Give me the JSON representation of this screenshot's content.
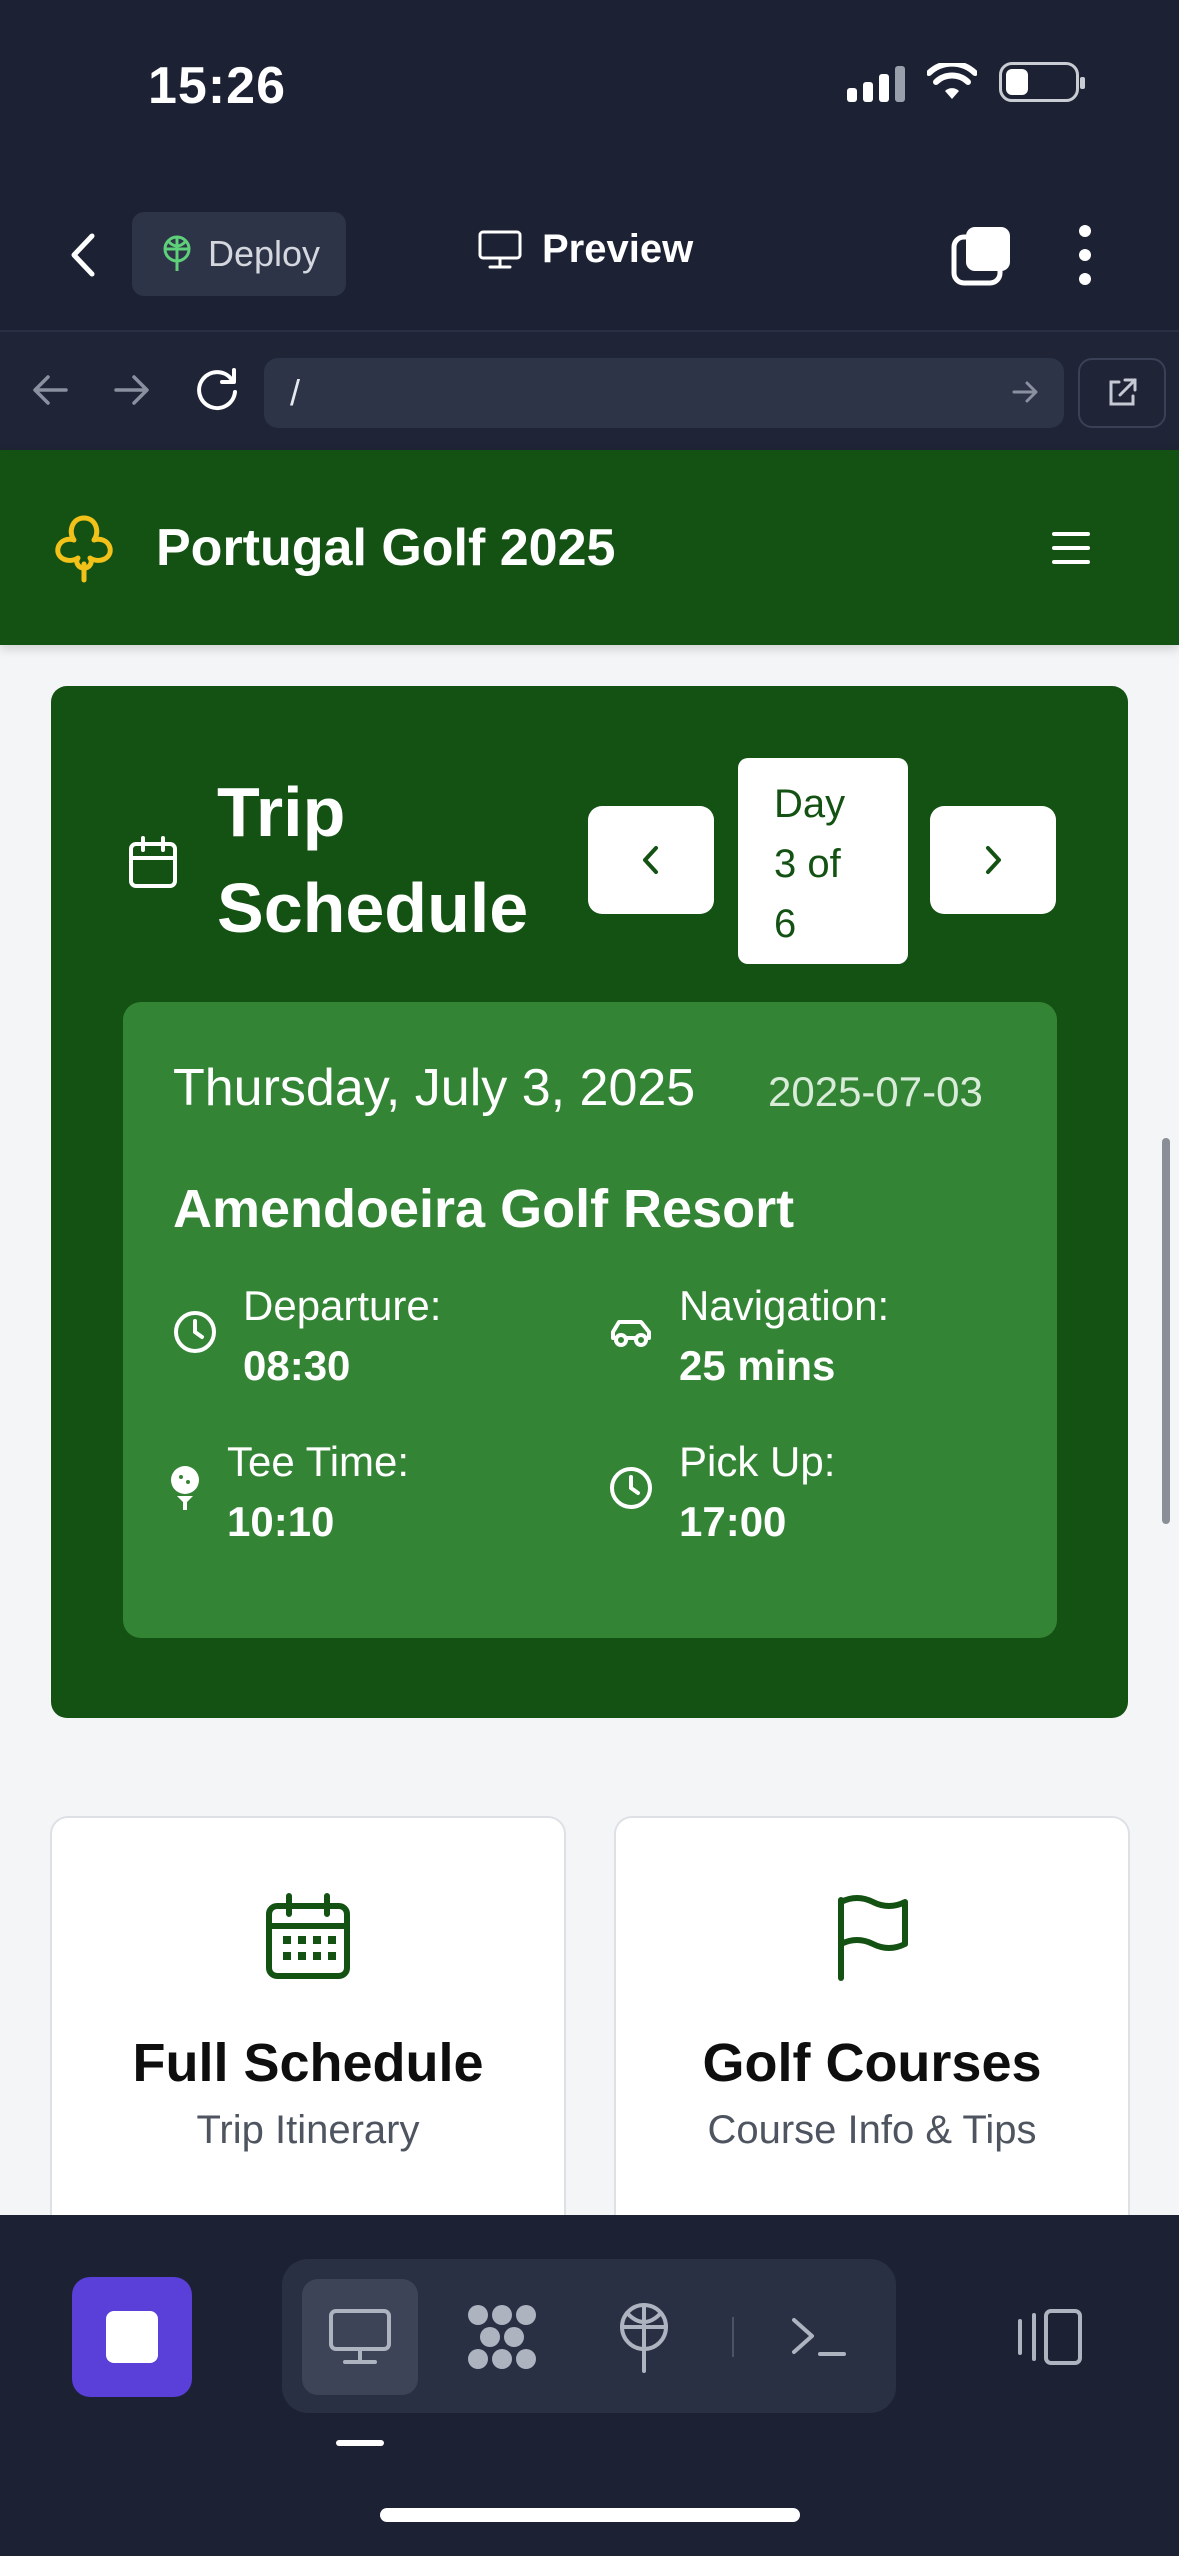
{
  "status_bar": {
    "time": "15:26"
  },
  "toolbar": {
    "deploy_label": "Deploy",
    "preview_label": "Preview"
  },
  "url_bar": {
    "value": "/"
  },
  "app": {
    "title": "Portugal Golf 2025"
  },
  "schedule": {
    "title": "Trip Schedule",
    "day_indicator": "Day 3 of 6",
    "day_indicator_lines": [
      "Day",
      "3 of",
      "6"
    ],
    "date_long": "Thursday, July 3, 2025",
    "date_iso": "2025-07-03",
    "course": "Amendoeira Golf Resort",
    "details": {
      "departure_label": "Departure:",
      "departure_value": "08:30",
      "navigation_label": "Navigation:",
      "navigation_value": "25 mins",
      "tee_label": "Tee Time:",
      "tee_value": "10:10",
      "pickup_label": "Pick Up:",
      "pickup_value": "17:00"
    }
  },
  "tiles": [
    {
      "title": "Full Schedule",
      "subtitle": "Trip Itinerary",
      "icon": "calendar-grid-icon"
    },
    {
      "title": "Golf Courses",
      "subtitle": "Course Info & Tips",
      "icon": "flag-icon"
    }
  ],
  "colors": {
    "chrome": "#1c2133",
    "brand_green": "#145214",
    "panel_green": "#338535",
    "clover_yellow": "#f2c21a",
    "stop_purple": "#5a3fd9"
  }
}
